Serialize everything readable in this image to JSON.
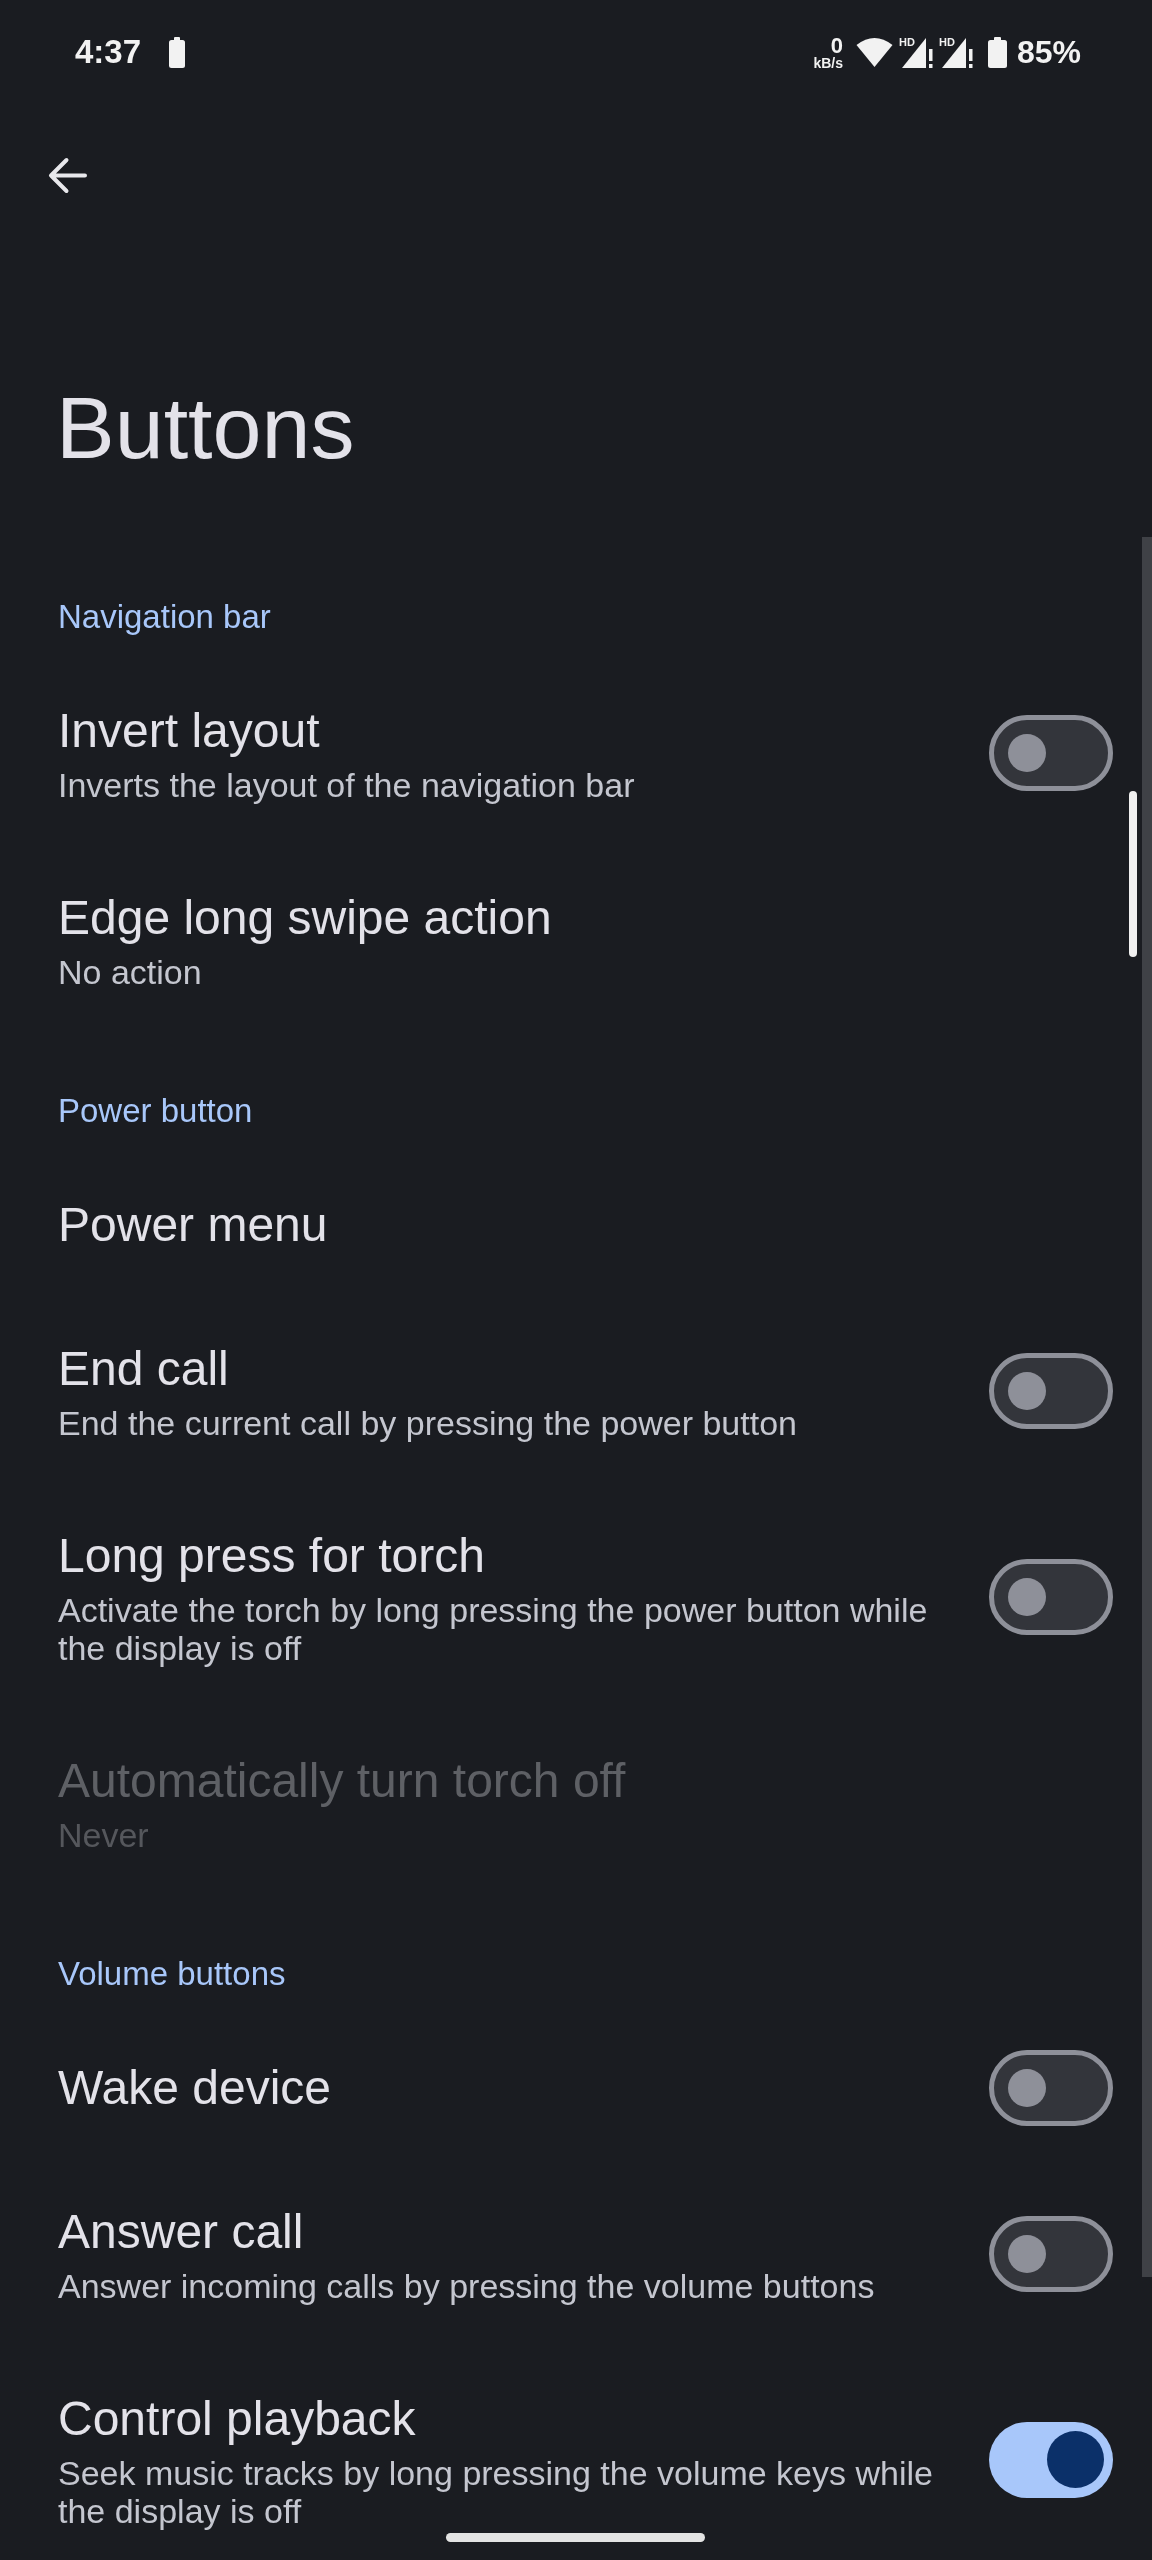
{
  "status_bar": {
    "time": "4:37",
    "net_speed": "0",
    "net_speed_unit": "kB/s",
    "signals": [
      {
        "label": "HD"
      },
      {
        "label": "HD"
      }
    ],
    "battery": "85%"
  },
  "title": "Buttons",
  "sections": [
    {
      "header": "Navigation bar",
      "items": [
        {
          "kind": "switch",
          "title": "Invert layout",
          "summary": "Inverts the layout of the navigation bar",
          "on": false,
          "disabled": false
        },
        {
          "kind": "link",
          "title": "Edge long swipe action",
          "summary": "No action",
          "disabled": false
        }
      ]
    },
    {
      "header": "Power button",
      "items": [
        {
          "kind": "link",
          "title": "Power menu",
          "disabled": false
        },
        {
          "kind": "switch",
          "title": "End call",
          "summary": "End the current call by pressing the power button",
          "on": false,
          "disabled": false
        },
        {
          "kind": "switch",
          "title": "Long press for torch",
          "summary": "Activate the torch by long pressing the power button while the display is off",
          "on": false,
          "disabled": false
        },
        {
          "kind": "link",
          "title": "Automatically turn torch off",
          "summary": "Never",
          "disabled": true
        }
      ]
    },
    {
      "header": "Volume buttons",
      "items": [
        {
          "kind": "switch",
          "title": "Wake device",
          "on": false,
          "disabled": false
        },
        {
          "kind": "switch",
          "title": "Answer call",
          "summary": "Answer incoming calls by pressing the volume buttons",
          "on": false,
          "disabled": false
        },
        {
          "kind": "switch",
          "title": "Control playback",
          "summary": "Seek music tracks by long pressing the volume keys while the display is off",
          "on": true,
          "disabled": false
        }
      ]
    }
  ]
}
